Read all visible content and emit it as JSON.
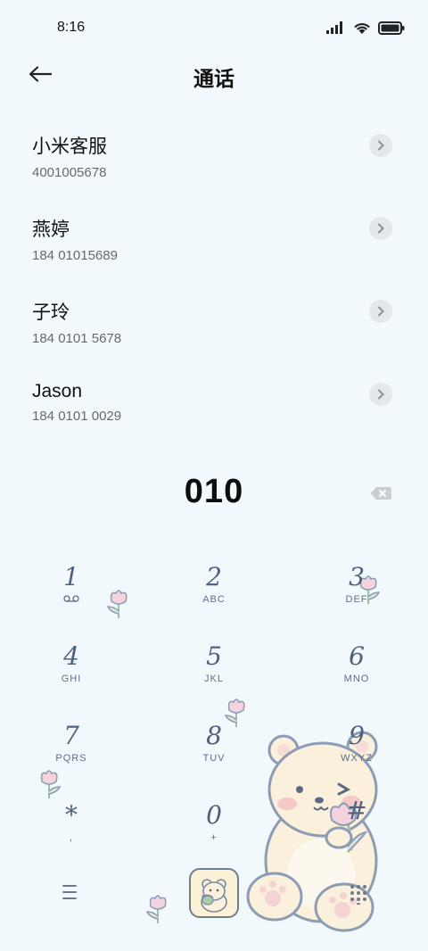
{
  "status_bar": {
    "time": "8:16"
  },
  "header": {
    "title": "通话"
  },
  "contacts": [
    {
      "name": "小米客服",
      "number": "4001005678"
    },
    {
      "name": "燕婷",
      "number": "184 01015689"
    },
    {
      "name": "子玲",
      "number": "184 0101 5678"
    },
    {
      "name": "Jason",
      "number": "184 0101 0029"
    }
  ],
  "dialer": {
    "input_value": "010"
  },
  "keypad": {
    "keys": [
      {
        "digit": "1",
        "letters": "∞"
      },
      {
        "digit": "2",
        "letters": "ABC"
      },
      {
        "digit": "3",
        "letters": "DEF"
      },
      {
        "digit": "4",
        "letters": "GHI"
      },
      {
        "digit": "5",
        "letters": "JKL"
      },
      {
        "digit": "6",
        "letters": "MNO"
      },
      {
        "digit": "7",
        "letters": "PQRS"
      },
      {
        "digit": "8",
        "letters": "TUV"
      },
      {
        "digit": "9",
        "letters": "WXYZ"
      },
      {
        "digit": "*",
        "letters": ","
      },
      {
        "digit": "0",
        "letters": "+"
      },
      {
        "digit": "#",
        "letters": ""
      }
    ]
  },
  "icons": {
    "back": "arrow-left-icon",
    "chevron": "chevron-right-icon",
    "backspace": "backspace-icon",
    "menu": "menu-icon",
    "call": "call-icon",
    "keypad_toggle": "dialpad-icon"
  },
  "colors": {
    "background": "#f2f9fc",
    "keypad_text": "#4e627e",
    "bear_fill": "#fbf0dc",
    "tulip_pink": "#f5d3dd"
  }
}
